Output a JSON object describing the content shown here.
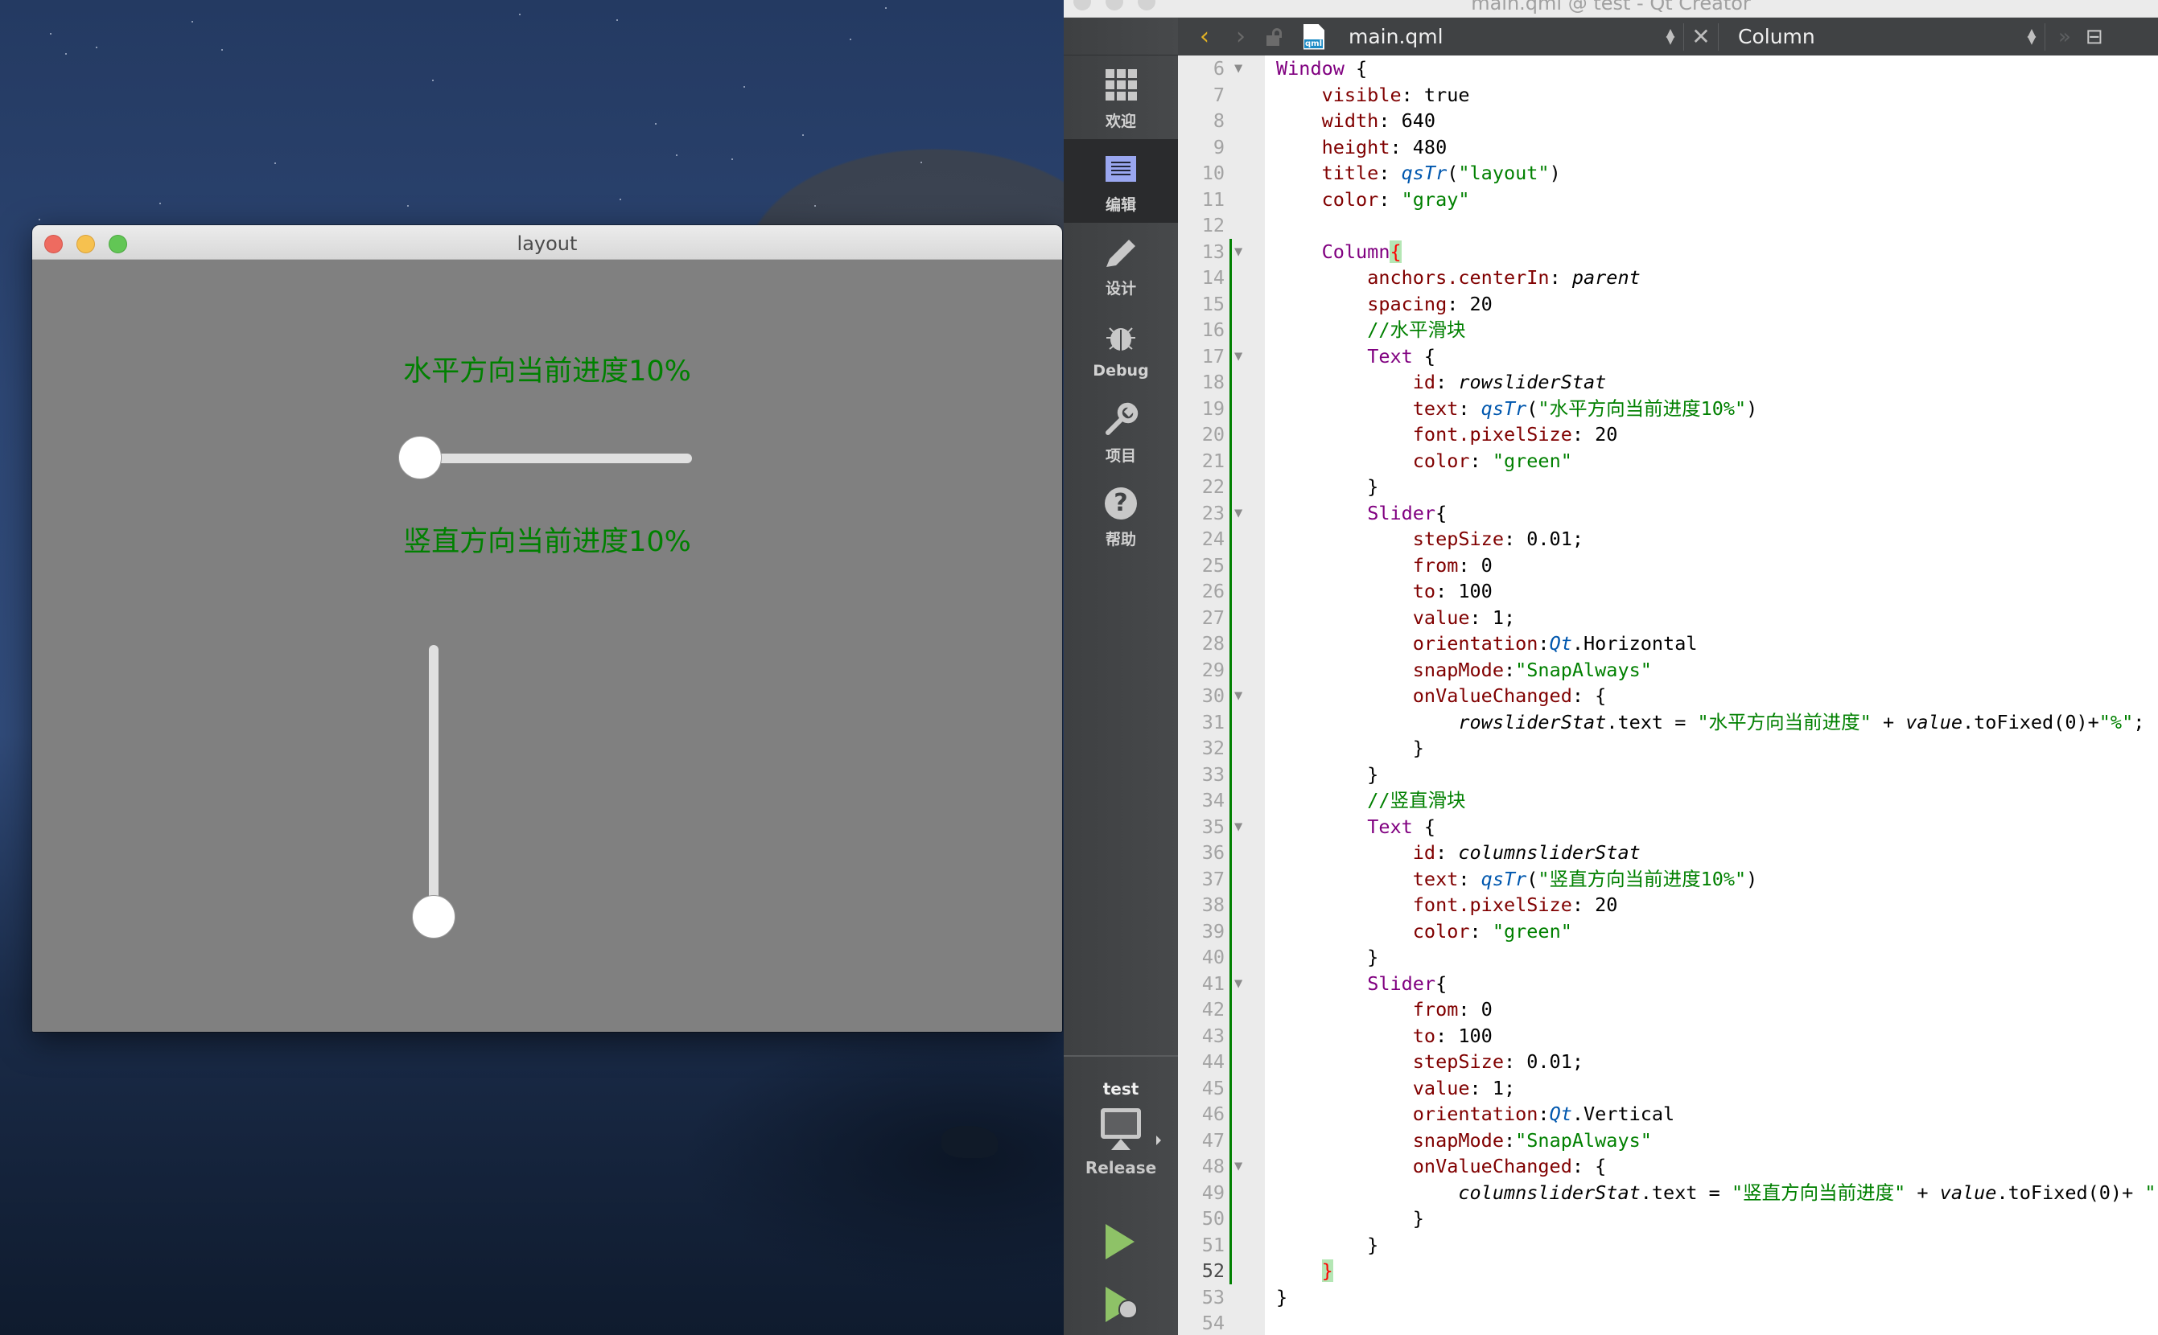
{
  "desktop": {
    "wallpaper": "macOS night coast"
  },
  "app_window": {
    "title": "layout",
    "background": "#808080",
    "horizontal_label": "水平方向当前进度10%",
    "vertical_label": "竖直方向当前进度10%",
    "label_color": "#008000",
    "horizontal_slider": {
      "from": 0,
      "to": 100,
      "value": 1
    },
    "vertical_slider": {
      "from": 0,
      "to": 100,
      "value": 1
    }
  },
  "creator": {
    "window_title": "main.qml @ test - Qt Creator",
    "modes": [
      {
        "label": "欢迎",
        "icon": "welcome-grid-icon"
      },
      {
        "label": "编辑",
        "icon": "edit-icon",
        "active": true
      },
      {
        "label": "设计",
        "icon": "design-pencil-icon"
      },
      {
        "label": "Debug",
        "icon": "debug-bug-icon"
      },
      {
        "label": "项目",
        "icon": "projects-wrench-icon"
      },
      {
        "label": "帮助",
        "icon": "help-icon"
      }
    ],
    "kit": {
      "project": "test",
      "config": "Release"
    },
    "toolbar": {
      "file_name": "main.qml",
      "file_badge": "qml",
      "symbol": "Column"
    },
    "code_lines": [
      {
        "n": 6,
        "fold": true,
        "bar": false,
        "html": "<span class='kw'>Window</span> {"
      },
      {
        "n": 7,
        "fold": false,
        "bar": false,
        "html": "    <span class='prop'>visible</span>: true"
      },
      {
        "n": 8,
        "fold": false,
        "bar": false,
        "html": "    <span class='prop'>width</span>: 640"
      },
      {
        "n": 9,
        "fold": false,
        "bar": false,
        "html": "    <span class='prop'>height</span>: 480"
      },
      {
        "n": 10,
        "fold": false,
        "bar": false,
        "html": "    <span class='prop'>title</span>: <span class='fn'>qsTr</span>(<span class='str'>\"layout\"</span>)"
      },
      {
        "n": 11,
        "fold": false,
        "bar": false,
        "html": "    <span class='prop'>color</span>: <span class='str'>\"gray\"</span>"
      },
      {
        "n": 12,
        "fold": false,
        "bar": false,
        "html": ""
      },
      {
        "n": 13,
        "fold": true,
        "bar": true,
        "html": "    <span class='kw'>Column</span><span class='brace-hl'>{</span>"
      },
      {
        "n": 14,
        "fold": false,
        "bar": true,
        "html": "        <span class='prop'>anchors.centerIn</span>: <span class='it'>parent</span>"
      },
      {
        "n": 15,
        "fold": false,
        "bar": true,
        "html": "        <span class='prop'>spacing</span>: 20"
      },
      {
        "n": 16,
        "fold": false,
        "bar": true,
        "html": "        <span class='cm'>//水平滑块</span>"
      },
      {
        "n": 17,
        "fold": true,
        "bar": true,
        "html": "        <span class='kw'>Text</span> {"
      },
      {
        "n": 18,
        "fold": false,
        "bar": true,
        "html": "            <span class='prop'>id</span>: <span class='it'>rowsliderStat</span>"
      },
      {
        "n": 19,
        "fold": false,
        "bar": true,
        "html": "            <span class='prop'>text</span>: <span class='fn'>qsTr</span>(<span class='str'>\"水平方向当前进度10%\"</span>)"
      },
      {
        "n": 20,
        "fold": false,
        "bar": true,
        "html": "            <span class='prop'>font.pixelSize</span>: 20"
      },
      {
        "n": 21,
        "fold": false,
        "bar": true,
        "html": "            <span class='prop'>color</span>: <span class='str'>\"green\"</span>"
      },
      {
        "n": 22,
        "fold": false,
        "bar": true,
        "html": "        }"
      },
      {
        "n": 23,
        "fold": true,
        "bar": true,
        "html": "        <span class='kw'>Slider</span>{"
      },
      {
        "n": 24,
        "fold": false,
        "bar": true,
        "html": "            <span class='prop'>stepSize</span>: 0.01;"
      },
      {
        "n": 25,
        "fold": false,
        "bar": true,
        "html": "            <span class='prop'>from</span>: 0"
      },
      {
        "n": 26,
        "fold": false,
        "bar": true,
        "html": "            <span class='prop'>to</span>: 100"
      },
      {
        "n": 27,
        "fold": false,
        "bar": true,
        "html": "            <span class='prop'>value</span>: 1;"
      },
      {
        "n": 28,
        "fold": false,
        "bar": true,
        "html": "            <span class='prop'>orientation</span>:<span class='fn'>Qt</span>.Horizontal"
      },
      {
        "n": 29,
        "fold": false,
        "bar": true,
        "html": "            <span class='prop'>snapMode</span>:<span class='str'>\"SnapAlways\"</span>"
      },
      {
        "n": 30,
        "fold": true,
        "bar": true,
        "html": "            <span class='prop'>onValueChanged</span>: {"
      },
      {
        "n": 31,
        "fold": false,
        "bar": true,
        "html": "                <span class='it'>rowsliderStat</span>.text = <span class='str'>\"水平方向当前进度\"</span> + <span class='it'>value</span>.toFixed(0)+<span class='str'>\"%\"</span>;"
      },
      {
        "n": 32,
        "fold": false,
        "bar": true,
        "html": "            }"
      },
      {
        "n": 33,
        "fold": false,
        "bar": true,
        "html": "        }"
      },
      {
        "n": 34,
        "fold": false,
        "bar": true,
        "html": "        <span class='cm'>//竖直滑块</span>"
      },
      {
        "n": 35,
        "fold": true,
        "bar": true,
        "html": "        <span class='kw'>Text</span> {"
      },
      {
        "n": 36,
        "fold": false,
        "bar": true,
        "html": "            <span class='prop'>id</span>: <span class='it'>columnsliderStat</span>"
      },
      {
        "n": 37,
        "fold": false,
        "bar": true,
        "html": "            <span class='prop'>text</span>: <span class='fn'>qsTr</span>(<span class='str'>\"竖直方向当前进度10%\"</span>)"
      },
      {
        "n": 38,
        "fold": false,
        "bar": true,
        "html": "            <span class='prop'>font.pixelSize</span>: 20"
      },
      {
        "n": 39,
        "fold": false,
        "bar": true,
        "html": "            <span class='prop'>color</span>: <span class='str'>\"green\"</span>"
      },
      {
        "n": 40,
        "fold": false,
        "bar": true,
        "html": "        }"
      },
      {
        "n": 41,
        "fold": true,
        "bar": true,
        "html": "        <span class='kw'>Slider</span>{"
      },
      {
        "n": 42,
        "fold": false,
        "bar": true,
        "html": "            <span class='prop'>from</span>: 0"
      },
      {
        "n": 43,
        "fold": false,
        "bar": true,
        "html": "            <span class='prop'>to</span>: 100"
      },
      {
        "n": 44,
        "fold": false,
        "bar": true,
        "html": "            <span class='prop'>stepSize</span>: 0.01;"
      },
      {
        "n": 45,
        "fold": false,
        "bar": true,
        "html": "            <span class='prop'>value</span>: 1;"
      },
      {
        "n": 46,
        "fold": false,
        "bar": true,
        "html": "            <span class='prop'>orientation</span>:<span class='fn'>Qt</span>.Vertical"
      },
      {
        "n": 47,
        "fold": false,
        "bar": true,
        "html": "            <span class='prop'>snapMode</span>:<span class='str'>\"SnapAlways\"</span>"
      },
      {
        "n": 48,
        "fold": true,
        "bar": true,
        "html": "            <span class='prop'>onValueChanged</span>: {"
      },
      {
        "n": 49,
        "fold": false,
        "bar": true,
        "html": "                <span class='it'>columnsliderStat</span>.text = <span class='str'>\"竖直方向当前进度\"</span> + <span class='it'>value</span>.toFixed(0)+ <span class='str'>\"</span>"
      },
      {
        "n": 50,
        "fold": false,
        "bar": true,
        "html": "            }"
      },
      {
        "n": 51,
        "fold": false,
        "bar": true,
        "html": "        }"
      },
      {
        "n": 52,
        "fold": false,
        "bar": true,
        "current": true,
        "html": "    <span class='brace-hl'>}</span>"
      },
      {
        "n": 53,
        "fold": false,
        "bar": false,
        "html": "}"
      },
      {
        "n": 54,
        "fold": false,
        "bar": false,
        "html": ""
      }
    ]
  }
}
